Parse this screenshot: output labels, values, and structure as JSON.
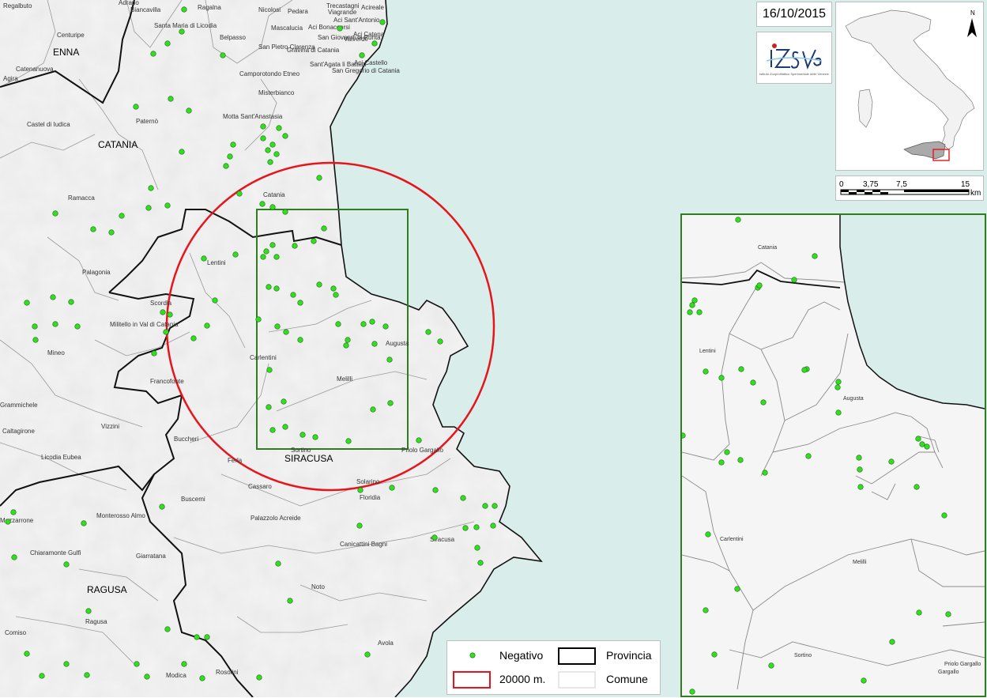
{
  "date": "16/10/2015",
  "logo": {
    "text": "IZSVe",
    "subtitle": "Istituto Zooprofilattico Sperimentale delle Venezie"
  },
  "provinces": [
    "ENNA",
    "CATANIA",
    "SIRACUSA",
    "RAGUSA"
  ],
  "comuni": [
    "Regalbuto",
    "Adrano",
    "Biancavilla",
    "Ragalna",
    "Nicolosi",
    "Pedara",
    "Trecastagni",
    "Viagrande",
    "Aci Sant'Antonio",
    "Acireale",
    "Centuripe",
    "Santa Maria di Licodia",
    "Belpasso",
    "Mascalucia",
    "Aci Bonaccorsi",
    "San Giovanni la Punta",
    "Valverde",
    "Aci Catena",
    "Aci Castello",
    "Catenanuova",
    "San Pietro Clarenza",
    "Gravina di Catania",
    "Sant'Agata li Battiati",
    "San Gregorio di Catania",
    "Agira",
    "Camporotondo Etneo",
    "Misterbianco",
    "Motta Sant'Anastasia",
    "Castel di Iudica",
    "Paternò",
    "Catania",
    "Ramacca",
    "Lentini",
    "Palagonia",
    "Scordia",
    "Militello in Val di Catania",
    "Carlentini",
    "Augusta",
    "Mineo",
    "Melilli",
    "Francofonte",
    "Grammichele",
    "Vizzini",
    "Caltagirone",
    "Buccheri",
    "Licodia Eubea",
    "Sortino",
    "Priolo Gargallo",
    "Ferla",
    "Solarino",
    "Cassaro",
    "Buscemi",
    "Floridia",
    "Monterosso Almo",
    "Mazzarrone",
    "Palazzolo Acreide",
    "Siracusa",
    "Giarratana",
    "Chiaramonte Gulfi",
    "Canicattini Bagni",
    "Noto",
    "Ragusa",
    "Comiso",
    "Avola",
    "Modica",
    "Rosolini"
  ],
  "inset_comuni": [
    "Catania",
    "Lentini",
    "Augusta",
    "Carlentini",
    "Melilli",
    "Sortino",
    "Priolo Gargallo"
  ],
  "scale": {
    "ticks": [
      "0",
      "3,75",
      "7,5",
      "15"
    ],
    "unit": "km"
  },
  "north": "N",
  "legend": {
    "negativo": "Negativo",
    "provincia": "Provincia",
    "radius": "20000 m.",
    "comune": "Comune"
  },
  "colors": {
    "sea": "#d9eeea",
    "land": "#f3f3f3",
    "point": "#33dd22",
    "circle": "#e8141b",
    "zone": "#2e7d1f"
  }
}
